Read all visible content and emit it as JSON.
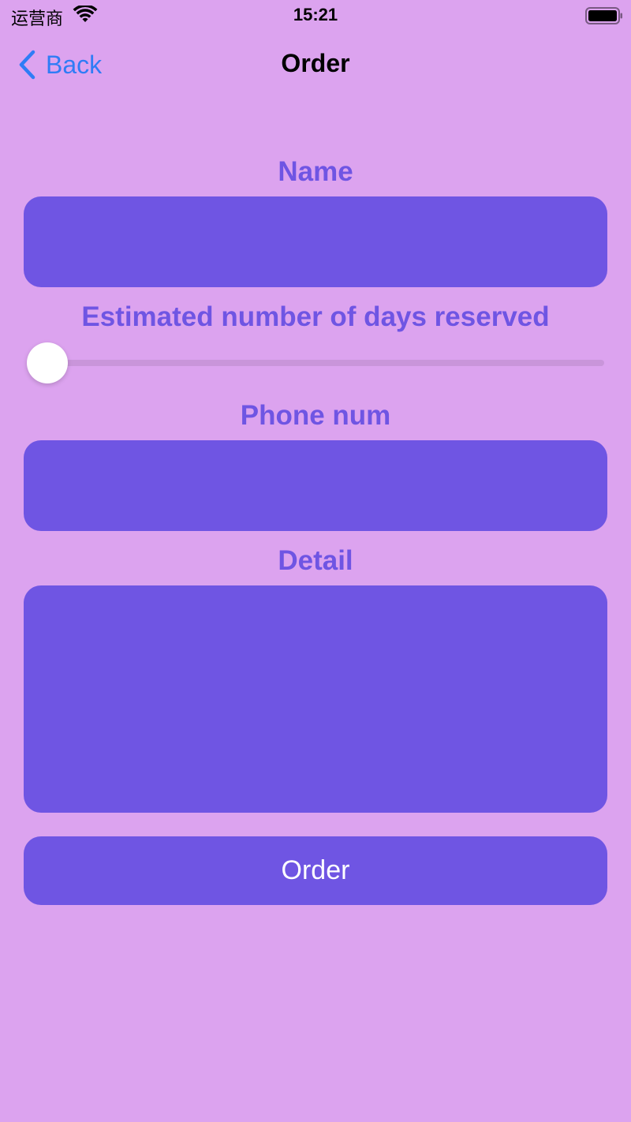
{
  "status_bar": {
    "carrier": "运营商",
    "time": "15:21",
    "wifi_icon": "wifi-icon",
    "battery_icon": "battery-icon"
  },
  "nav": {
    "back_label": "Back",
    "back_icon": "chevron-left-icon",
    "title": "Order"
  },
  "form": {
    "name_label": "Name",
    "name_value": "",
    "days_label": "Estimated number of days reserved",
    "days_slider_fraction": 0,
    "phone_label": "Phone num",
    "phone_value": "",
    "detail_label": "Detail",
    "detail_value": ""
  },
  "order_button_label": "Order",
  "colors": {
    "background": "#DCA3EF",
    "accent": "#6F55E3",
    "link": "#2F7CF6",
    "slider_track": "#C995DA"
  }
}
